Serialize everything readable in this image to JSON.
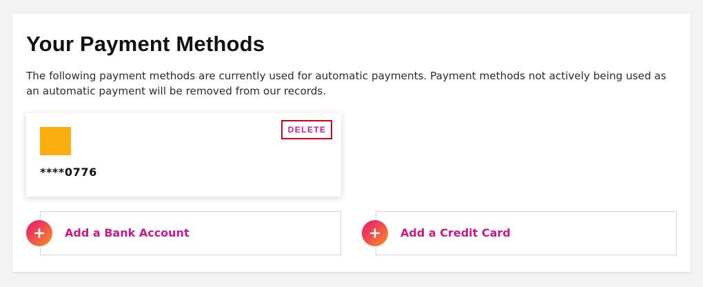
{
  "page": {
    "title": "Your Payment Methods",
    "description": "The following payment methods are currently used for automatic payments. Payment methods not actively being used as an automatic payment will be removed from our records."
  },
  "payment_methods": [
    {
      "masked_number": "****0776",
      "logo_color": "#fbae0f",
      "delete_label": "DELETE"
    }
  ],
  "actions": {
    "add_bank_label": "Add a Bank Account",
    "add_card_label": "Add a Credit Card",
    "icon": "plus-icon"
  },
  "colors": {
    "accent": "#c8198a",
    "delete_border": "#d0021b",
    "gradient_start": "#e8136f",
    "gradient_end": "#f7931e"
  }
}
